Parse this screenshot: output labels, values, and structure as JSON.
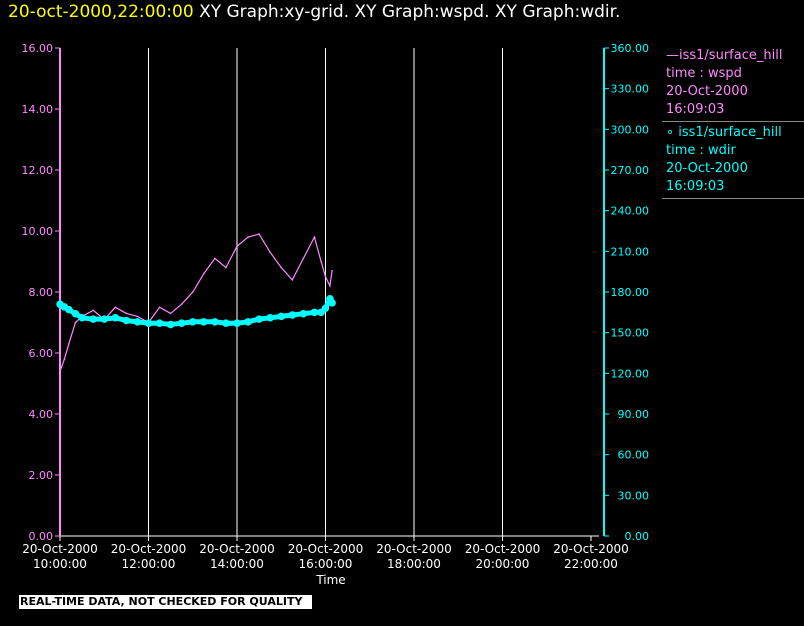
{
  "header": {
    "timestamp": "20-oct-2000,22:00:00",
    "graphs": "XY Graph:xy-grid.  XY Graph:wspd.  XY Graph:wdir."
  },
  "legend": {
    "series1": {
      "line1": "iss1/surface_hill",
      "line2": "time : wspd",
      "line3": "20-Oct-2000",
      "line4": "16:09:03"
    },
    "series2": {
      "line1": "iss1/surface_hill",
      "line2": "time : wdir",
      "line3": "20-Oct-2000",
      "line4": "16:09:03"
    }
  },
  "footer": {
    "quality_note": "REAL-TIME DATA, NOT CHECKED FOR QUALITY"
  },
  "chart_data": {
    "type": "line",
    "xlabel": "Time",
    "x_tick_labels": [
      [
        "20-Oct-2000",
        "10:00:00"
      ],
      [
        "20-Oct-2000",
        "12:00:00"
      ],
      [
        "20-Oct-2000",
        "14:00:00"
      ],
      [
        "20-Oct-2000",
        "16:00:00"
      ],
      [
        "20-Oct-2000",
        "18:00:00"
      ],
      [
        "20-Oct-2000",
        "20:00:00"
      ],
      [
        "20-Oct-2000",
        "22:00:00"
      ]
    ],
    "xlim_hours": [
      10,
      22
    ],
    "ylim_left": [
      0,
      16
    ],
    "yticks_left": [
      "0.00",
      "2.00",
      "4.00",
      "6.00",
      "8.00",
      "10.00",
      "12.00",
      "14.00",
      "16.00"
    ],
    "ylim_right": [
      0,
      360
    ],
    "yticks_right": [
      "0.00",
      "30.00",
      "60.00",
      "90.00",
      "120.00",
      "150.00",
      "180.00",
      "210.00",
      "240.00",
      "270.00",
      "300.00",
      "330.00",
      "360.00"
    ],
    "grid": "vertical",
    "colors": {
      "wspd": "#ff88ff",
      "wdir": "#00ffff",
      "left_axis": "#ff88ff",
      "right_axis": "#00ffff",
      "grid": "#ffffff"
    },
    "series": [
      {
        "name": "wspd",
        "axis": "left",
        "style": "line",
        "x": [
          10.0,
          10.1,
          10.2,
          10.35,
          10.5,
          10.75,
          11.0,
          11.25,
          11.5,
          11.75,
          12.0,
          12.25,
          12.5,
          12.75,
          13.0,
          13.25,
          13.5,
          13.75,
          14.0,
          14.25,
          14.5,
          14.75,
          15.0,
          15.25,
          15.5,
          15.75,
          15.9,
          16.0,
          16.1,
          16.15
        ],
        "y": [
          5.4,
          5.8,
          6.3,
          7.0,
          7.2,
          7.4,
          7.1,
          7.5,
          7.3,
          7.2,
          7.0,
          7.5,
          7.3,
          7.6,
          8.0,
          8.6,
          9.1,
          8.8,
          9.5,
          9.8,
          9.9,
          9.3,
          8.8,
          8.4,
          9.1,
          9.8,
          9.0,
          8.5,
          8.2,
          8.7
        ]
      },
      {
        "name": "wdir",
        "axis": "right",
        "style": "markers",
        "x": [
          10.0,
          10.1,
          10.2,
          10.35,
          10.5,
          10.75,
          11.0,
          11.25,
          11.5,
          11.75,
          12.0,
          12.25,
          12.5,
          12.75,
          13.0,
          13.25,
          13.5,
          13.75,
          14.0,
          14.25,
          14.5,
          14.75,
          15.0,
          15.25,
          15.5,
          15.75,
          15.9,
          16.0,
          16.1,
          16.15
        ],
        "y": [
          171,
          169,
          167,
          164,
          161,
          160,
          160,
          161,
          159,
          158,
          157,
          157,
          156,
          157,
          158,
          158,
          158,
          157,
          157,
          158,
          160,
          161,
          162,
          163,
          164,
          165,
          165,
          168,
          175,
          172
        ]
      }
    ]
  }
}
